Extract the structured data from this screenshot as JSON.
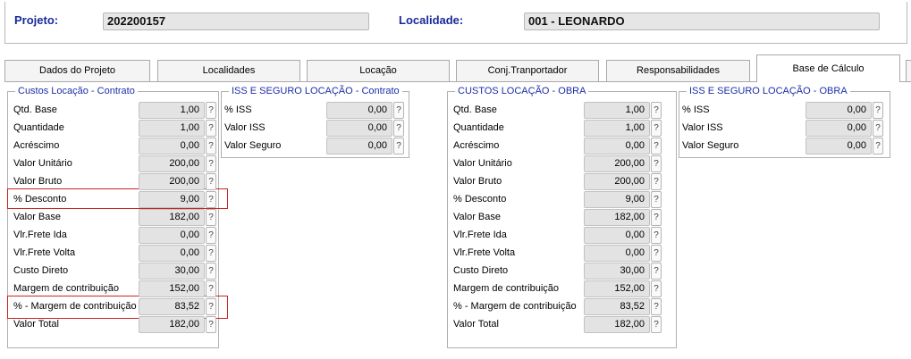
{
  "header": {
    "projeto_label": "Projeto:",
    "projeto_value": "202200157",
    "localidade_label": "Localidade:",
    "localidade_value": "001 - LEONARDO"
  },
  "tabs": [
    {
      "label": "Dados do Projeto"
    },
    {
      "label": "Localidades"
    },
    {
      "label": "Locação"
    },
    {
      "label": "Conj.Tranportador"
    },
    {
      "label": "Responsabilidades"
    },
    {
      "label": "Base de Cálculo",
      "active": true
    }
  ],
  "groups": {
    "custos_contrato": {
      "title": "Custos Locação - Contrato",
      "rows": [
        {
          "label": "Qtd. Base",
          "value": "1,00"
        },
        {
          "label": "Quantidade",
          "value": "1,00"
        },
        {
          "label": "Acréscimo",
          "value": "0,00"
        },
        {
          "label": "Valor Unitário",
          "value": "200,00"
        },
        {
          "label": "Valor Bruto",
          "value": "200,00"
        },
        {
          "label": "% Desconto",
          "value": "9,00"
        },
        {
          "label": "Valor Base",
          "value": "182,00"
        },
        {
          "label": "Vlr.Frete Ida",
          "value": "0,00"
        },
        {
          "label": "Vlr.Frete Volta",
          "value": "0,00"
        },
        {
          "label": "Custo Direto",
          "value": "30,00"
        },
        {
          "label": "Margem de contribuição",
          "value": "152,00"
        },
        {
          "label": "% - Margem de contribuição",
          "value": "83,52"
        },
        {
          "label": "Valor Total",
          "value": "182,00"
        }
      ]
    },
    "iss_contrato": {
      "title": "ISS E SEGURO LOCAÇÃO - Contrato",
      "rows": [
        {
          "label": "% ISS",
          "value": "0,00"
        },
        {
          "label": "Valor ISS",
          "value": "0,00"
        },
        {
          "label": "Valor Seguro",
          "value": "0,00"
        }
      ]
    },
    "custos_obra": {
      "title": "CUSTOS LOCAÇÃO - OBRA",
      "rows": [
        {
          "label": "Qtd. Base",
          "value": "1,00"
        },
        {
          "label": "Quantidade",
          "value": "1,00"
        },
        {
          "label": "Acréscimo",
          "value": "0,00"
        },
        {
          "label": "Valor Unitário",
          "value": "200,00"
        },
        {
          "label": "Valor Bruto",
          "value": "200,00"
        },
        {
          "label": "% Desconto",
          "value": "9,00"
        },
        {
          "label": "Valor Base",
          "value": "182,00"
        },
        {
          "label": "Vlr.Frete Ida",
          "value": "0,00"
        },
        {
          "label": "Vlr.Frete Volta",
          "value": "0,00"
        },
        {
          "label": "Custo Direto",
          "value": "30,00"
        },
        {
          "label": "Margem de contribuição",
          "value": "152,00"
        },
        {
          "label": "% - Margem de contribuição",
          "value": "83,52"
        },
        {
          "label": "Valor Total",
          "value": "182,00"
        }
      ]
    },
    "iss_obra": {
      "title": "ISS E SEGURO LOCAÇÃO - OBRA",
      "rows": [
        {
          "label": "% ISS",
          "value": "0,00"
        },
        {
          "label": "Valor ISS",
          "value": "0,00"
        },
        {
          "label": "Valor Seguro",
          "value": "0,00"
        }
      ]
    }
  },
  "help_button": "?",
  "colors": {
    "label_blue": "#1a2a9a",
    "highlight_red": "#cc2222",
    "field_bg": "#e3e3e3"
  }
}
